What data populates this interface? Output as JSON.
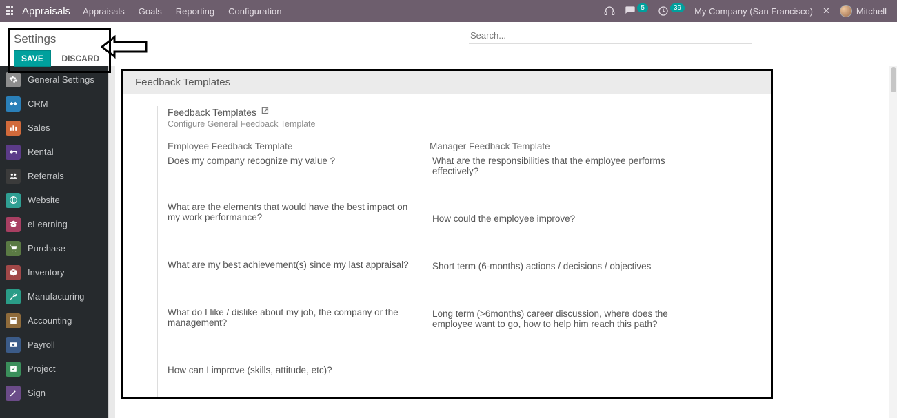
{
  "navbar": {
    "brand": "Appraisals",
    "items": [
      "Appraisals",
      "Goals",
      "Reporting",
      "Configuration"
    ],
    "msg_badge": "5",
    "clock_badge": "39",
    "company": "My Company (San Francisco)",
    "user": "Mitchell"
  },
  "action_bar": {
    "title": "Settings",
    "save": "SAVE",
    "discard": "DISCARD",
    "search_placeholder": "Search..."
  },
  "sidebar": {
    "items": [
      {
        "label": "General Settings",
        "color": "#8d8d8d"
      },
      {
        "label": "CRM",
        "color": "#2a7fb8"
      },
      {
        "label": "Sales",
        "color": "#d16a3b"
      },
      {
        "label": "Rental",
        "color": "#5b3b88"
      },
      {
        "label": "Referrals",
        "color": "#3b3b3b"
      },
      {
        "label": "Website",
        "color": "#2f9f93"
      },
      {
        "label": "eLearning",
        "color": "#a83f62"
      },
      {
        "label": "Purchase",
        "color": "#5a7a44"
      },
      {
        "label": "Inventory",
        "color": "#a14848"
      },
      {
        "label": "Manufacturing",
        "color": "#2a9c87"
      },
      {
        "label": "Accounting",
        "color": "#8f6b3b"
      },
      {
        "label": "Payroll",
        "color": "#3b5b88"
      },
      {
        "label": "Project",
        "color": "#3b8f5b"
      },
      {
        "label": "Sign",
        "color": "#6b4b88"
      }
    ]
  },
  "panel": {
    "title": "Feedback Templates",
    "subhead": "Feedback Templates",
    "subcaption": "Configure General Feedback Template",
    "emp_title": "Employee Feedback Template",
    "mgr_title": "Manager Feedback Template",
    "emp": [
      "Does my company recognize my value ?",
      "What are the elements that would have the best impact on my work performance?",
      "What are my best achievement(s) since my last appraisal?",
      "What do I like / dislike about my job, the company or the management?",
      "How can I improve (skills, attitude, etc)?"
    ],
    "mgr": [
      "What are the responsibilities that the employee performs effectively?",
      "How could the employee improve?",
      "Short term (6-months) actions / decisions / objectives",
      "Long term (>6months) career discussion, where does the employee want to go, how to help him reach this path?"
    ]
  }
}
